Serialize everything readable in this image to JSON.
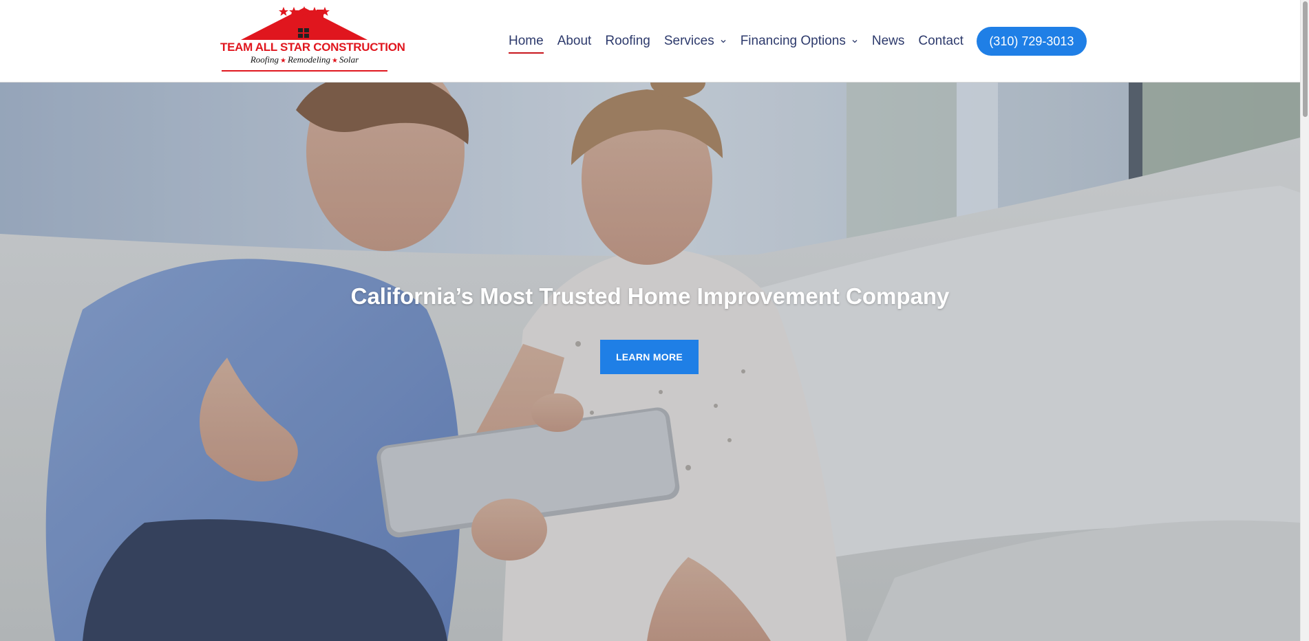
{
  "logo": {
    "title": "TEAM ALL STAR CONSTRUCTION",
    "subtitle_1": "Roofing",
    "subtitle_2": "Remodeling",
    "subtitle_3": "Solar",
    "star_glyph": "★",
    "brand_red": "#e0161e"
  },
  "nav": {
    "items": [
      {
        "label": "Home",
        "active": true
      },
      {
        "label": "About"
      },
      {
        "label": "Roofing"
      },
      {
        "label": "Services",
        "dropdown": true
      },
      {
        "label": "Financing Options",
        "dropdown": true
      },
      {
        "label": "News"
      },
      {
        "label": "Contact"
      }
    ],
    "phone": "(310) 729-3013",
    "accent": "#1f7fe6"
  },
  "hero": {
    "title": "California’s Most Trusted Home Improvement Company",
    "cta": "LEARN MORE"
  }
}
